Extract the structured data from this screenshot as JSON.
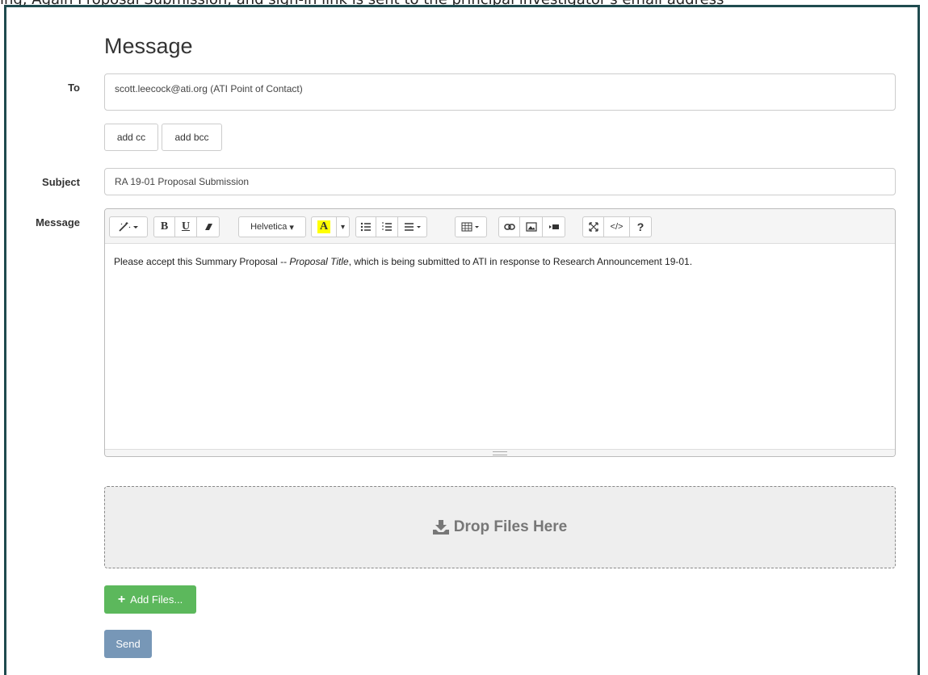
{
  "caption": "ing, Again Proposal Submission, and sign-in link is sent to the principal investigator's email address",
  "page": {
    "title": "Message"
  },
  "form": {
    "to_label": "To",
    "to_value": "scott.leecock@ati.org (ATI Point of Contact)",
    "add_cc": "add cc",
    "add_bcc": "add bcc",
    "subject_label": "Subject",
    "subject_value": "RA 19-01 Proposal Submission",
    "message_label": "Message"
  },
  "editor": {
    "font_name": "Helvetica",
    "body_before": "Please accept this Summary Proposal -- ",
    "body_italic": "Proposal Title",
    "body_after": ", which is being submitted to ATI in response to Research Announcement 19-01.",
    "toolbar": [
      "magic-icon",
      "bold-icon",
      "underline-icon",
      "eraser-icon",
      "font-name",
      "text-color-icon",
      "color-dropdown-icon",
      "unordered-list-icon",
      "ordered-list-icon",
      "align-icon",
      "table-icon",
      "link-icon",
      "picture-icon",
      "video-icon",
      "fullscreen-icon",
      "code-view-icon",
      "help-icon"
    ]
  },
  "dropzone": {
    "label": "Drop Files Here"
  },
  "actions": {
    "add_files": "Add Files...",
    "send": "Send"
  },
  "colors": {
    "frame": "#1f4b4f",
    "add_files_bg": "#5cb85c",
    "send_bg": "#7797b7",
    "dropzone_bg": "#eeeeee"
  }
}
